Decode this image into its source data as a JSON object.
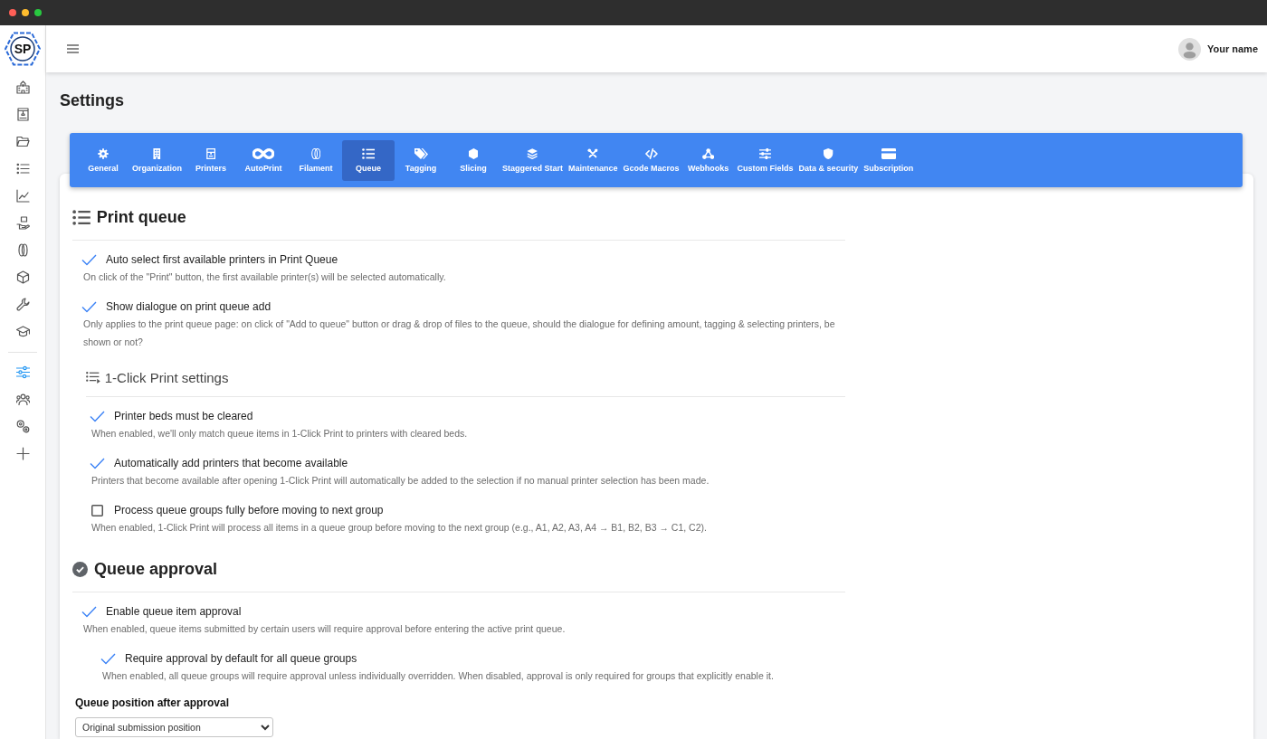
{
  "sidebar": {
    "logo": "SP",
    "groups": [
      {
        "items": [
          {
            "selected": false
          },
          {
            "selected": false
          },
          {
            "selected": false
          },
          {
            "selected": false
          },
          {
            "selected": false
          },
          {
            "selected": false
          },
          {
            "selected": false
          },
          {
            "selected": false
          },
          {
            "selected": false
          },
          {
            "selected": false
          }
        ]
      },
      {
        "items": [
          {
            "selected": true
          },
          {
            "selected": false
          },
          {
            "selected": false
          },
          {
            "selected": false
          }
        ]
      }
    ]
  },
  "header": {
    "user_name": "Your name"
  },
  "page_title": "Settings",
  "tabs": [
    {
      "label": "General",
      "selected": false
    },
    {
      "label": "Organization",
      "selected": false
    },
    {
      "label": "Printers",
      "selected": false
    },
    {
      "label": "AutoPrint",
      "selected": false
    },
    {
      "label": "Filament",
      "selected": false
    },
    {
      "label": "Queue",
      "selected": true
    },
    {
      "label": "Tagging",
      "selected": false
    },
    {
      "label": "Slicing",
      "selected": false
    },
    {
      "label": "Staggered Start",
      "selected": false
    },
    {
      "label": "Maintenance",
      "selected": false
    },
    {
      "label": "Gcode Macros",
      "selected": false
    },
    {
      "label": "Webhooks",
      "selected": false
    },
    {
      "label": "Custom Fields",
      "selected": false
    },
    {
      "label": "Data & security",
      "selected": false
    },
    {
      "label": "Subscription",
      "selected": false
    }
  ],
  "sections": [
    {
      "kind": "main",
      "title": "Print queue",
      "settings": [
        {
          "label": "Auto select first available printers in Print Queue",
          "description": "On click of the \"Print\" button, the first available printer(s) will be selected automatically.",
          "checked": true
        },
        {
          "label": "Show dialogue on print queue add",
          "description": "Only applies to the print queue page: on click of \"Add to queue\" button or drag & drop of files to the queue, should the dialogue for defining amount, tagging & selecting printers, be shown or not?",
          "checked": true
        }
      ]
    },
    {
      "kind": "sub",
      "title": "1-Click Print settings",
      "settings": [
        {
          "label": "Printer beds must be cleared",
          "description": "When enabled, we'll only match queue items in 1-Click Print to printers with cleared beds.",
          "checked": true
        },
        {
          "label": "Automatically add printers that become available",
          "description": "Printers that become available after opening 1-Click Print will automatically be added to the selection if no manual printer selection has been made.",
          "checked": true
        },
        {
          "label": "Process queue groups fully before moving to next group",
          "description": "When enabled, 1-Click Print will process all items in a queue group before moving to the next group (e.g., A1, A2, A3, A4 → B1, B2, B3 → C1, C2).",
          "checked": false
        }
      ]
    },
    {
      "kind": "main",
      "title": "Queue approval",
      "settings": [
        {
          "label": "Enable queue item approval",
          "description": "When enabled, queue items submitted by certain users will require approval before entering the active print queue.",
          "checked": true,
          "children": [
            {
              "label": "Require approval by default for all queue groups",
              "description": "When enabled, all queue groups will require approval unless individually overridden. When disabled, approval is only required for groups that explicitly enable it.",
              "checked": true
            }
          ]
        }
      ],
      "field": {
        "label": "Queue position after approval",
        "value": "Original submission position"
      }
    }
  ]
}
